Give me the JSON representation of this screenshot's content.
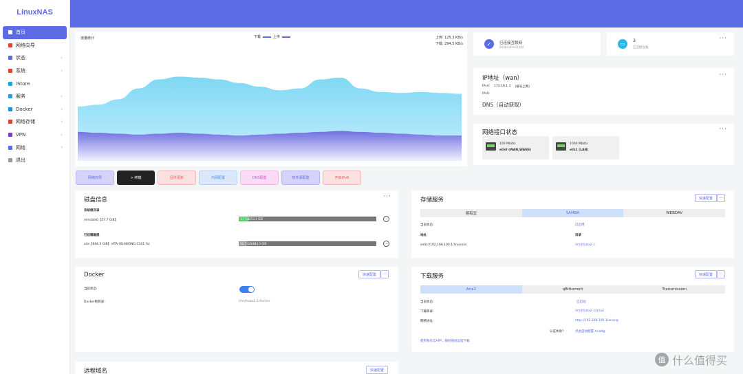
{
  "app": {
    "logo": "LinuxNAS"
  },
  "sidebar": {
    "items": [
      {
        "label": "首页",
        "icon": "home-icon",
        "color": "#ffffff",
        "active": true
      },
      {
        "label": "网络向导",
        "icon": "wizard-icon",
        "color": "#e0442e"
      },
      {
        "label": "状态",
        "icon": "grid-icon",
        "color": "#5b6be3",
        "arrow": "›"
      },
      {
        "label": "系统",
        "icon": "gear-icon",
        "color": "#e0442e",
        "arrow": "›"
      },
      {
        "label": "iStore",
        "icon": "store-icon",
        "color": "#1da2e6"
      },
      {
        "label": "服务",
        "icon": "service-icon",
        "color": "#22a0e6",
        "arrow": "›"
      },
      {
        "label": "Docker",
        "icon": "docker-icon",
        "color": "#1d8fe6",
        "arrow": "›"
      },
      {
        "label": "网络存储",
        "icon": "storage-icon",
        "color": "#e0442e",
        "arrow": "›"
      },
      {
        "label": "VPN",
        "icon": "vpn-icon",
        "color": "#7a3bd6",
        "arrow": "›"
      },
      {
        "label": "网络",
        "icon": "network-icon",
        "color": "#5b6be3",
        "arrow": "›"
      },
      {
        "label": "退出",
        "icon": "logout-icon",
        "color": "#999999"
      }
    ]
  },
  "traffic": {
    "title": "流量统计",
    "legend_down": "下载",
    "legend_up": "上传",
    "upload": "上传: 125.3 KB/s",
    "download": "下载: 294.5 KB/s"
  },
  "chart_data": {
    "type": "area",
    "series": [
      {
        "name": "上传",
        "color": "#7fd8f3",
        "values": [
          60,
          62,
          68,
          80,
          90,
          93,
          92,
          90,
          86,
          82,
          78,
          80,
          90,
          92,
          80,
          76,
          75,
          76,
          75,
          74
        ]
      },
      {
        "name": "下载",
        "color": "#7a7fe6",
        "values": [
          32,
          31,
          30,
          29,
          30,
          31,
          30,
          29,
          28,
          29,
          30,
          31,
          32,
          33,
          32,
          31,
          30,
          29,
          28,
          28
        ]
      }
    ],
    "ylim": [
      0,
      120
    ],
    "grid": false,
    "legend": "top-center"
  },
  "status": {
    "internet": {
      "title": "已连接互联网",
      "sub": "0次未(n0)ns(24)秒"
    },
    "devices": {
      "count": "3",
      "sub": "已连接设备"
    },
    "ip": {
      "title": "IP地址（wan）",
      "ipv4_label": "IPv4:",
      "ipv4": "172.16.1.1",
      "ipv4_note": "(拨号上网)",
      "ipv6_label": "IPv6:",
      "dns": "DNS（自动获取）"
    },
    "iface": {
      "title": "网络接口状态",
      "ports": [
        {
          "speed": "100 Mbit/s",
          "name": "eth0 (WAN,WAN6)"
        },
        {
          "speed": "1000 Mbit/s",
          "name": "eth1 (LAN)"
        }
      ]
    }
  },
  "actions": [
    {
      "label": "网络向导",
      "bg": "#d6d3fb",
      "fg": "#5b6be3",
      "border": "#b8b6f0"
    },
    {
      "label": "> 终端",
      "bg": "#222222",
      "fg": "#ffffff",
      "border": "#222222"
    },
    {
      "label": "固件更新",
      "bg": "#fde0e0",
      "fg": "#e06060",
      "border": "#f4b8b8"
    },
    {
      "label": "内网配置",
      "bg": "#dbe8fb",
      "fg": "#4a8ae6",
      "border": "#b8d0f4"
    },
    {
      "label": "DNS配置",
      "bg": "#fbdcf4",
      "fg": "#d055c0",
      "border": "#f0b8e6"
    },
    {
      "label": "软件源配置",
      "bg": "#d6d3fb",
      "fg": "#5b6be3",
      "border": "#b8b6f0"
    },
    {
      "label": "开启IPv6",
      "bg": "#fde0e0",
      "fg": "#e06060",
      "border": "#f4b8b8"
    }
  ],
  "disk": {
    "title": "磁盘信息",
    "sys_label": "系统根目录",
    "sys_name": "mmcblk0【57.7 GiB】",
    "sys_bar": "3.7 GiB/53.4 GiB",
    "sys_fill": 0.07,
    "mnt_label": "已挂载磁盘",
    "mnt_name": "sda【894.3 GiB】(ATA QUANXING C101 %)",
    "mnt_bar": "50.7 GiB/844.3 GiB",
    "mnt_fill": 0.06
  },
  "docker": {
    "title": "Docker",
    "quick": "快速配置",
    "state_label": "当前状态:",
    "root_label": "Docker根目录:",
    "root_value": "/mnt/sata2-1/docker"
  },
  "storage": {
    "title": "存储服务",
    "quick": "快速配置",
    "tabs": [
      "易有云",
      "SAMBA",
      "WEBDAV"
    ],
    "state_label": "当前状态:",
    "state_value": "已启用",
    "addr_label": "地址",
    "dir_label": "目录",
    "addr_value": "smb://192.168.100.1/linuxnas",
    "dir_value": "/mnt/sata2-1"
  },
  "download": {
    "title": "下载服务",
    "quick": "快速配置",
    "tabs": [
      "Aria2",
      "qBittorrent",
      "Transmission"
    ],
    "state_label": "当前状态:",
    "state_value": "已启动",
    "dir_label": "下载目录:",
    "dir_value": "/mnt/sata2-1/aria2",
    "web_label": "网络地址:",
    "web_value": "http://192.168.100.1/ariang",
    "auth_label": "认证失败?",
    "auth_link": "点此自动配置 AriaNg",
    "app_link": "使用易有云APP，随时随地远程下载"
  },
  "remote": {
    "title": "远程域名",
    "quick": "快速配置"
  },
  "watermark": {
    "text": "什么值得买"
  }
}
